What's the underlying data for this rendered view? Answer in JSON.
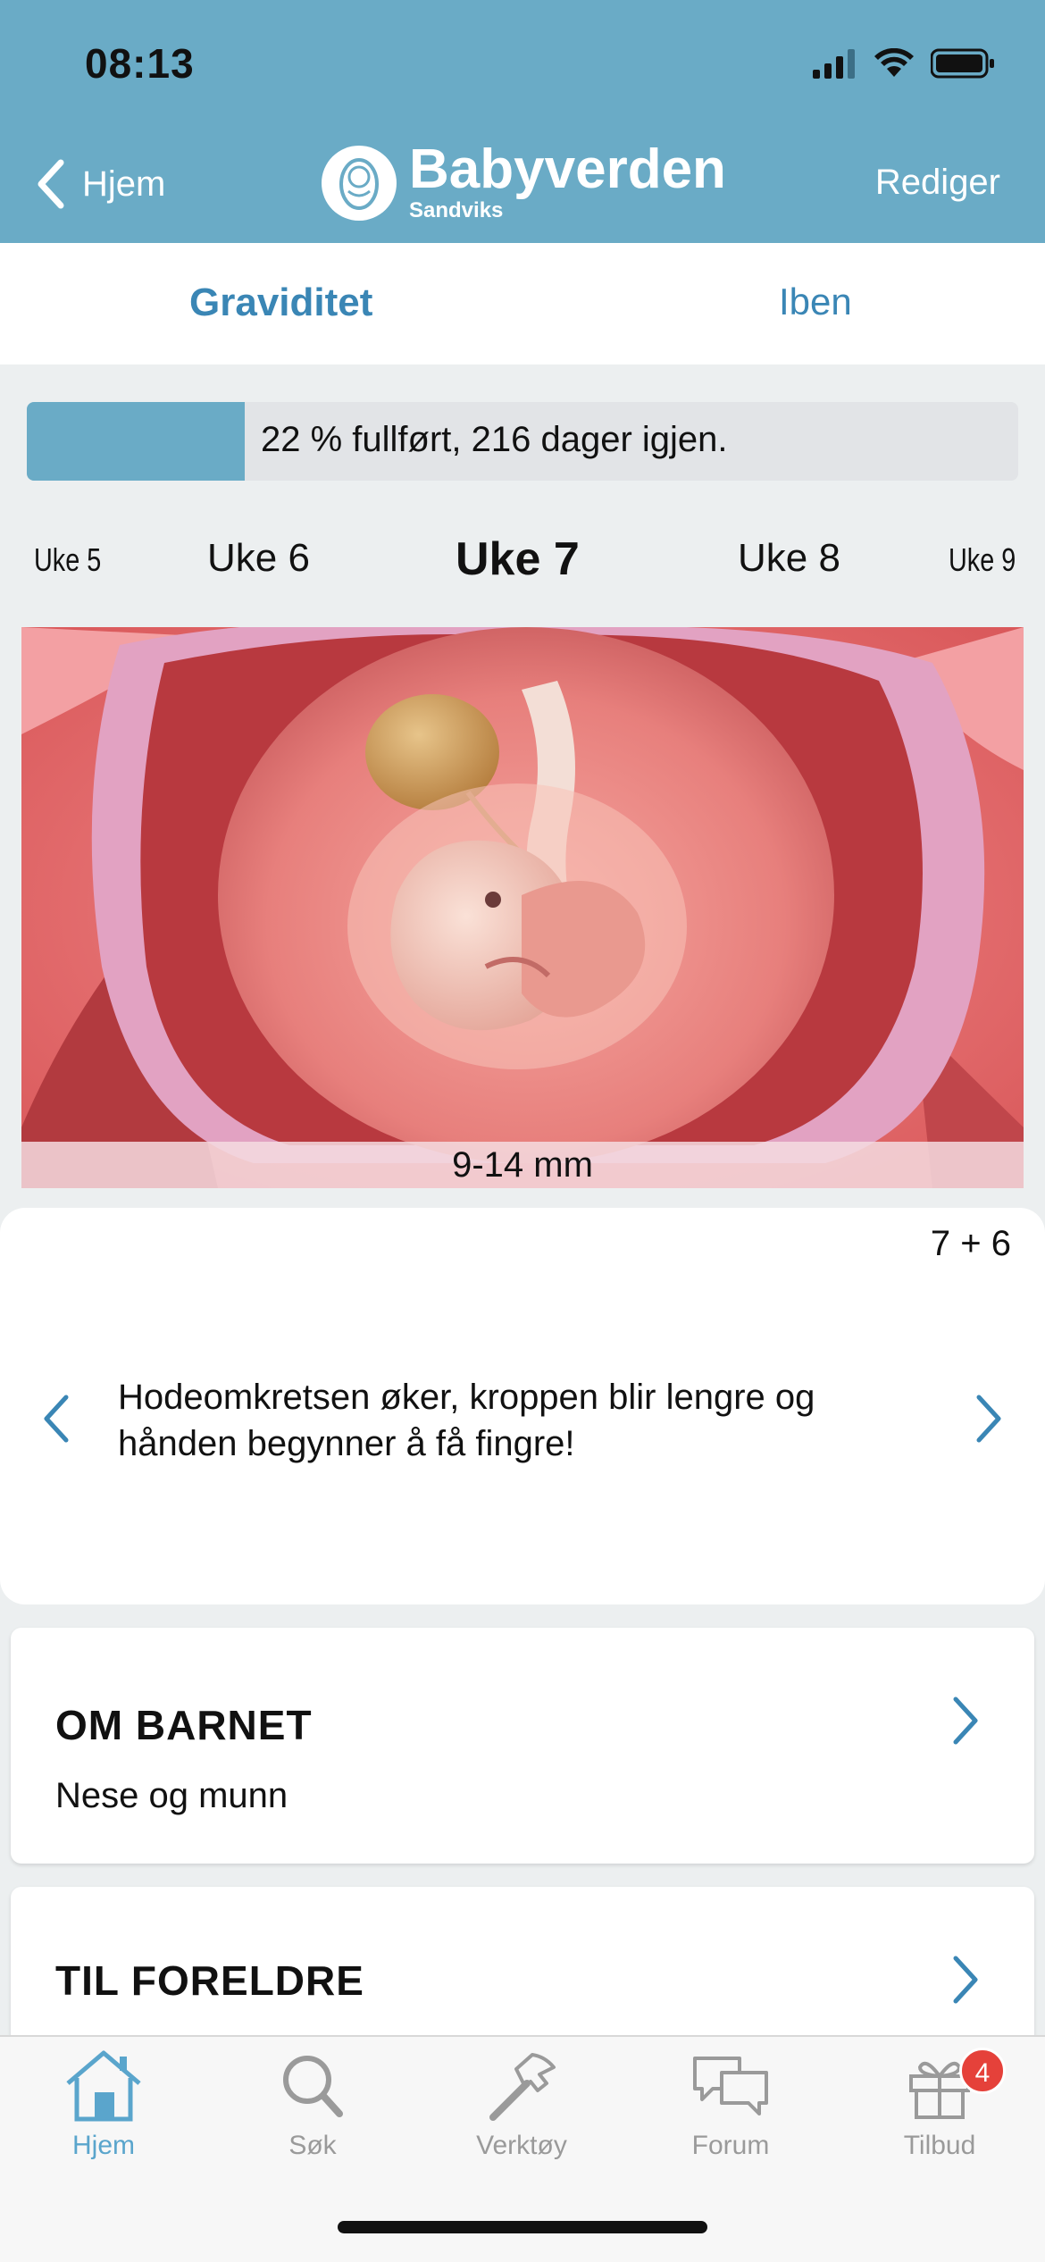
{
  "status_bar": {
    "time": "08:13"
  },
  "nav": {
    "back_label": "Hjem",
    "logo_main": "Babyverden",
    "logo_sub": "Sandviks",
    "edit_label": "Rediger"
  },
  "tabs": [
    {
      "label": "Graviditet",
      "active": true
    },
    {
      "label": "Iben",
      "active": false
    }
  ],
  "progress": {
    "percent": 22,
    "text": "22 % fullført, 216 dager igjen."
  },
  "weeks": [
    "Uke 5",
    "Uke 6",
    "Uke 7",
    "Uke 8",
    "Uke 9"
  ],
  "current_week": "Uke 7",
  "image": {
    "size_caption": "9-14 mm"
  },
  "fact": {
    "day": "7 + 6",
    "text": "Hodeomkretsen øker, kroppen blir lengre og hånden begynner å få fingre!"
  },
  "sections": [
    {
      "title": "OM BARNET",
      "subtitle": "Nese og munn"
    },
    {
      "title": "TIL FORELDRE"
    }
  ],
  "tabbar": {
    "items": [
      {
        "label": "Hjem",
        "icon": "home-icon",
        "active": true
      },
      {
        "label": "Søk",
        "icon": "search-icon"
      },
      {
        "label": "Verktøy",
        "icon": "hammer-icon"
      },
      {
        "label": "Forum",
        "icon": "chat-bubbles-icon"
      },
      {
        "label": "Tilbud",
        "icon": "gift-icon",
        "badge": "4"
      }
    ]
  },
  "colors": {
    "accent": "#6aabc6",
    "link": "#3a86b5",
    "badge": "#e5413a"
  }
}
